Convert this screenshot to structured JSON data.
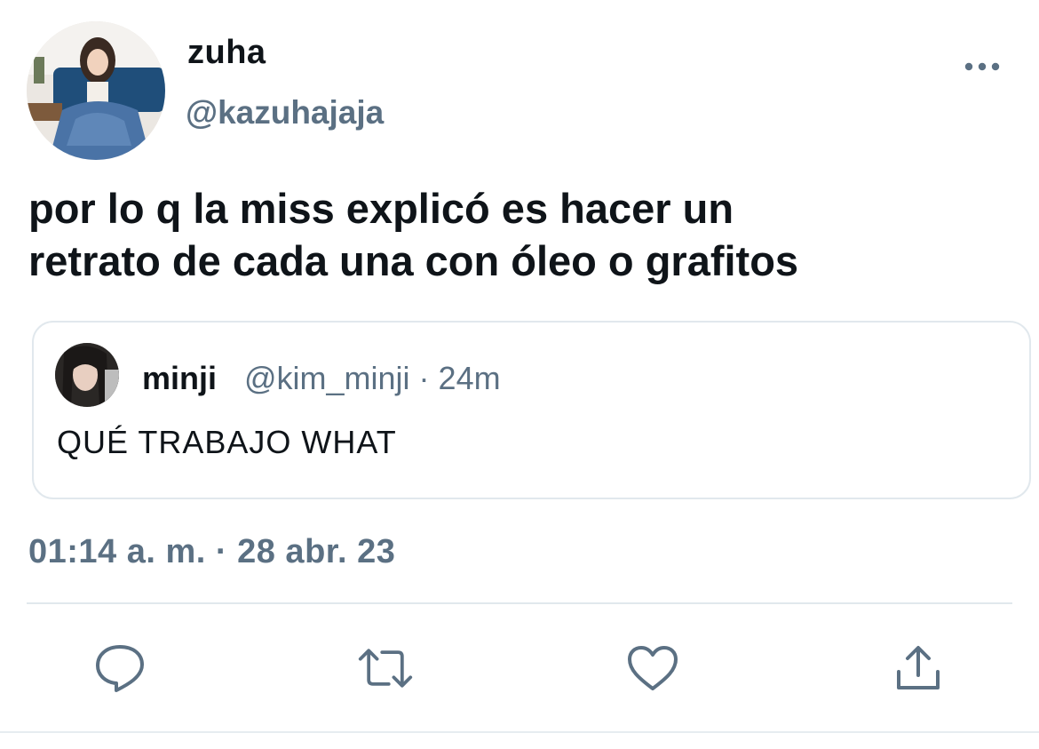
{
  "author": {
    "display_name": "zuha",
    "handle": "@kazuhajaja",
    "avatar_icon": "profile-photo"
  },
  "tweet": {
    "text_line1": "por lo q la miss explicó es hacer un",
    "text_line2": "retrato de cada una con óleo o grafitos",
    "timestamp": "01:14 a. m. · 28 abr. 23"
  },
  "quoted_tweet": {
    "display_name": "minji",
    "meta": "@kim_minji · 24m",
    "text": "QUÉ TRABAJO WHAT",
    "avatar_icon": "profile-photo"
  },
  "actions": [
    {
      "name": "reply",
      "icon": "reply-icon"
    },
    {
      "name": "retweet",
      "icon": "retweet-icon"
    },
    {
      "name": "like",
      "icon": "heart-icon"
    },
    {
      "name": "share",
      "icon": "share-icon"
    }
  ],
  "colors": {
    "primary_text": "#0f1419",
    "secondary_text": "#5b7083",
    "border": "#e1e8ed",
    "icon": "#5b7083"
  }
}
